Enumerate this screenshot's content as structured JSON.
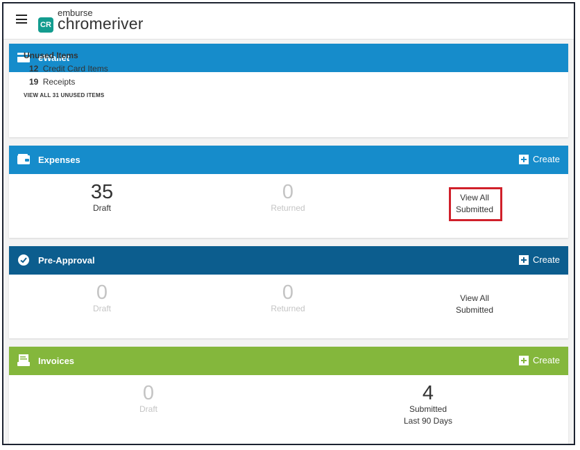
{
  "header": {
    "brand_top": "emburse",
    "brand_main": "chromeriver",
    "brand_mark": "CR"
  },
  "ewallet": {
    "title": "eWallet",
    "unused_heading": "Unused Items",
    "credit_card_count": "12",
    "credit_card_label": "Credit Card Items",
    "receipts_count": "19",
    "receipts_label": "Receipts",
    "view_all_link": "VIEW ALL 31 UNUSED ITEMS"
  },
  "expenses": {
    "title": "Expenses",
    "create_label": "Create",
    "draft_count": "35",
    "draft_label": "Draft",
    "returned_count": "0",
    "returned_label": "Returned",
    "view_all_line1": "View All",
    "view_all_line2": "Submitted"
  },
  "preapproval": {
    "title": "Pre-Approval",
    "create_label": "Create",
    "draft_count": "0",
    "draft_label": "Draft",
    "returned_count": "0",
    "returned_label": "Returned",
    "view_all_line1": "View All",
    "view_all_line2": "Submitted"
  },
  "invoices": {
    "title": "Invoices",
    "create_label": "Create",
    "draft_count": "0",
    "draft_label": "Draft",
    "submitted_count": "4",
    "submitted_label": "Submitted",
    "submitted_sub": "Last 90 Days"
  },
  "colors": {
    "ewallet_header": "#168ccb",
    "expenses_header": "#168ccb",
    "preapproval_header": "#0c5d8e",
    "invoices_header": "#84b73c",
    "highlight_box": "#d0202a",
    "brand_mark": "#139c8f"
  },
  "icons": {
    "menu": "hamburger-icon",
    "ewallet": "card-icon",
    "expenses": "wallet-icon",
    "preapproval": "check-badge-icon",
    "invoices": "invoice-icon",
    "create": "plus-square-icon"
  }
}
